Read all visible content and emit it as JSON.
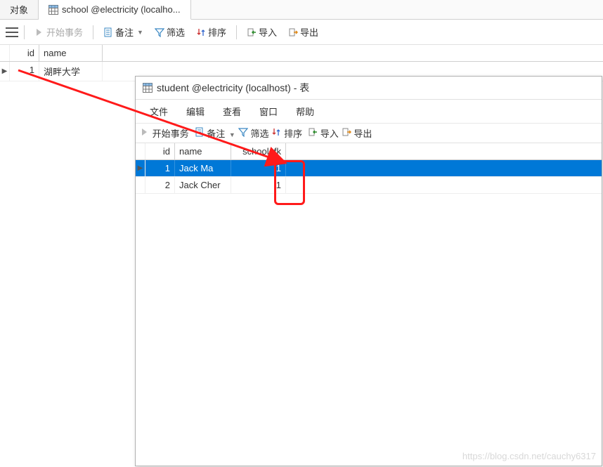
{
  "main_tabs": {
    "objects": "对象",
    "school": "school @electricity (localho..."
  },
  "toolbar": {
    "start_tx": "开始事务",
    "note": "备注",
    "filter": "筛选",
    "sort": "排序",
    "import": "导入",
    "export": "导出"
  },
  "school_grid": {
    "columns": {
      "id": "id",
      "name": "name"
    },
    "rows": [
      {
        "id": "1",
        "name": "湖畔大学"
      }
    ]
  },
  "sub_window": {
    "title": "student @electricity (localhost) - 表",
    "menu": {
      "file": "文件",
      "edit": "编辑",
      "view": "查看",
      "window": "窗口",
      "help": "帮助"
    },
    "toolbar": {
      "start_tx": "开始事务",
      "note": "备注",
      "filter": "筛选",
      "sort": "排序",
      "import": "导入",
      "export": "导出"
    },
    "grid": {
      "columns": {
        "id": "id",
        "name": "name",
        "fk": "school_fk"
      },
      "rows": [
        {
          "id": "1",
          "name": "Jack Ma",
          "fk": "1",
          "selected": true
        },
        {
          "id": "2",
          "name": "Jack Cher",
          "fk": "1",
          "selected": false
        }
      ]
    }
  },
  "icons": {
    "grid": "table-grid-icon",
    "note": "note-icon",
    "filter": "funnel-icon",
    "sort": "sort-icon",
    "import": "import-icon",
    "export": "export-icon",
    "arrow_right": "arrow-right-icon"
  },
  "watermark": "https://blog.csdn.net/cauchy6317"
}
